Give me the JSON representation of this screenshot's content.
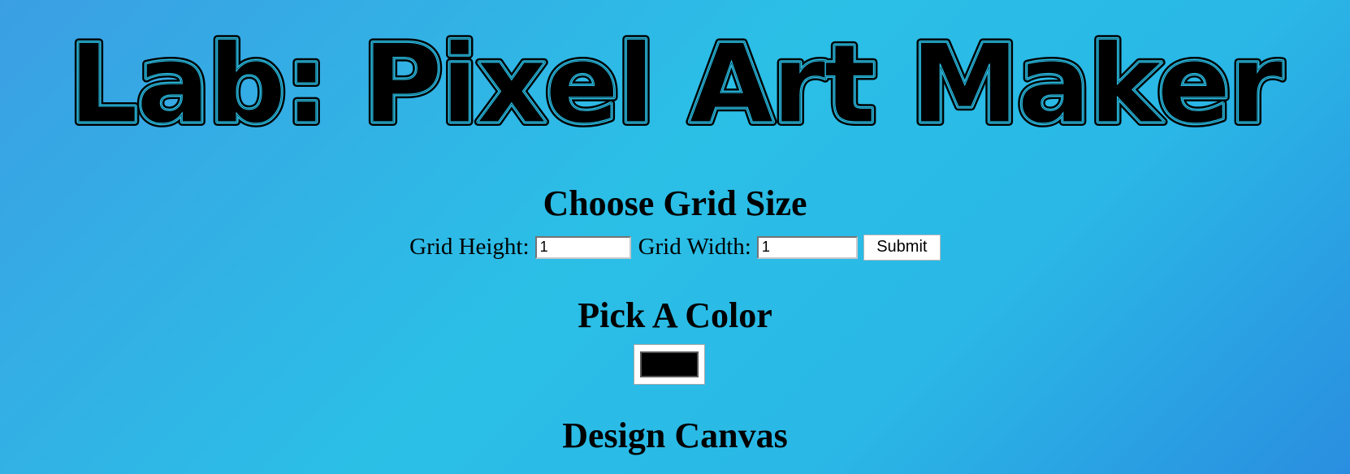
{
  "page": {
    "title": "Lab: Pixel Art Maker"
  },
  "grid_size": {
    "heading": "Choose Grid Size",
    "height_label": "Grid Height:",
    "height_value": "1",
    "width_label": "Grid Width:",
    "width_value": "1",
    "submit_label": "Submit"
  },
  "color": {
    "heading": "Pick A Color",
    "selected_color": "#000000"
  },
  "canvas": {
    "heading": "Design Canvas"
  },
  "theme": {
    "background_start": "#3b9fe4",
    "background_mid": "#2bbfe6",
    "background_end": "#2a8ee0",
    "title_stripe_color": "#2bbfe6"
  }
}
